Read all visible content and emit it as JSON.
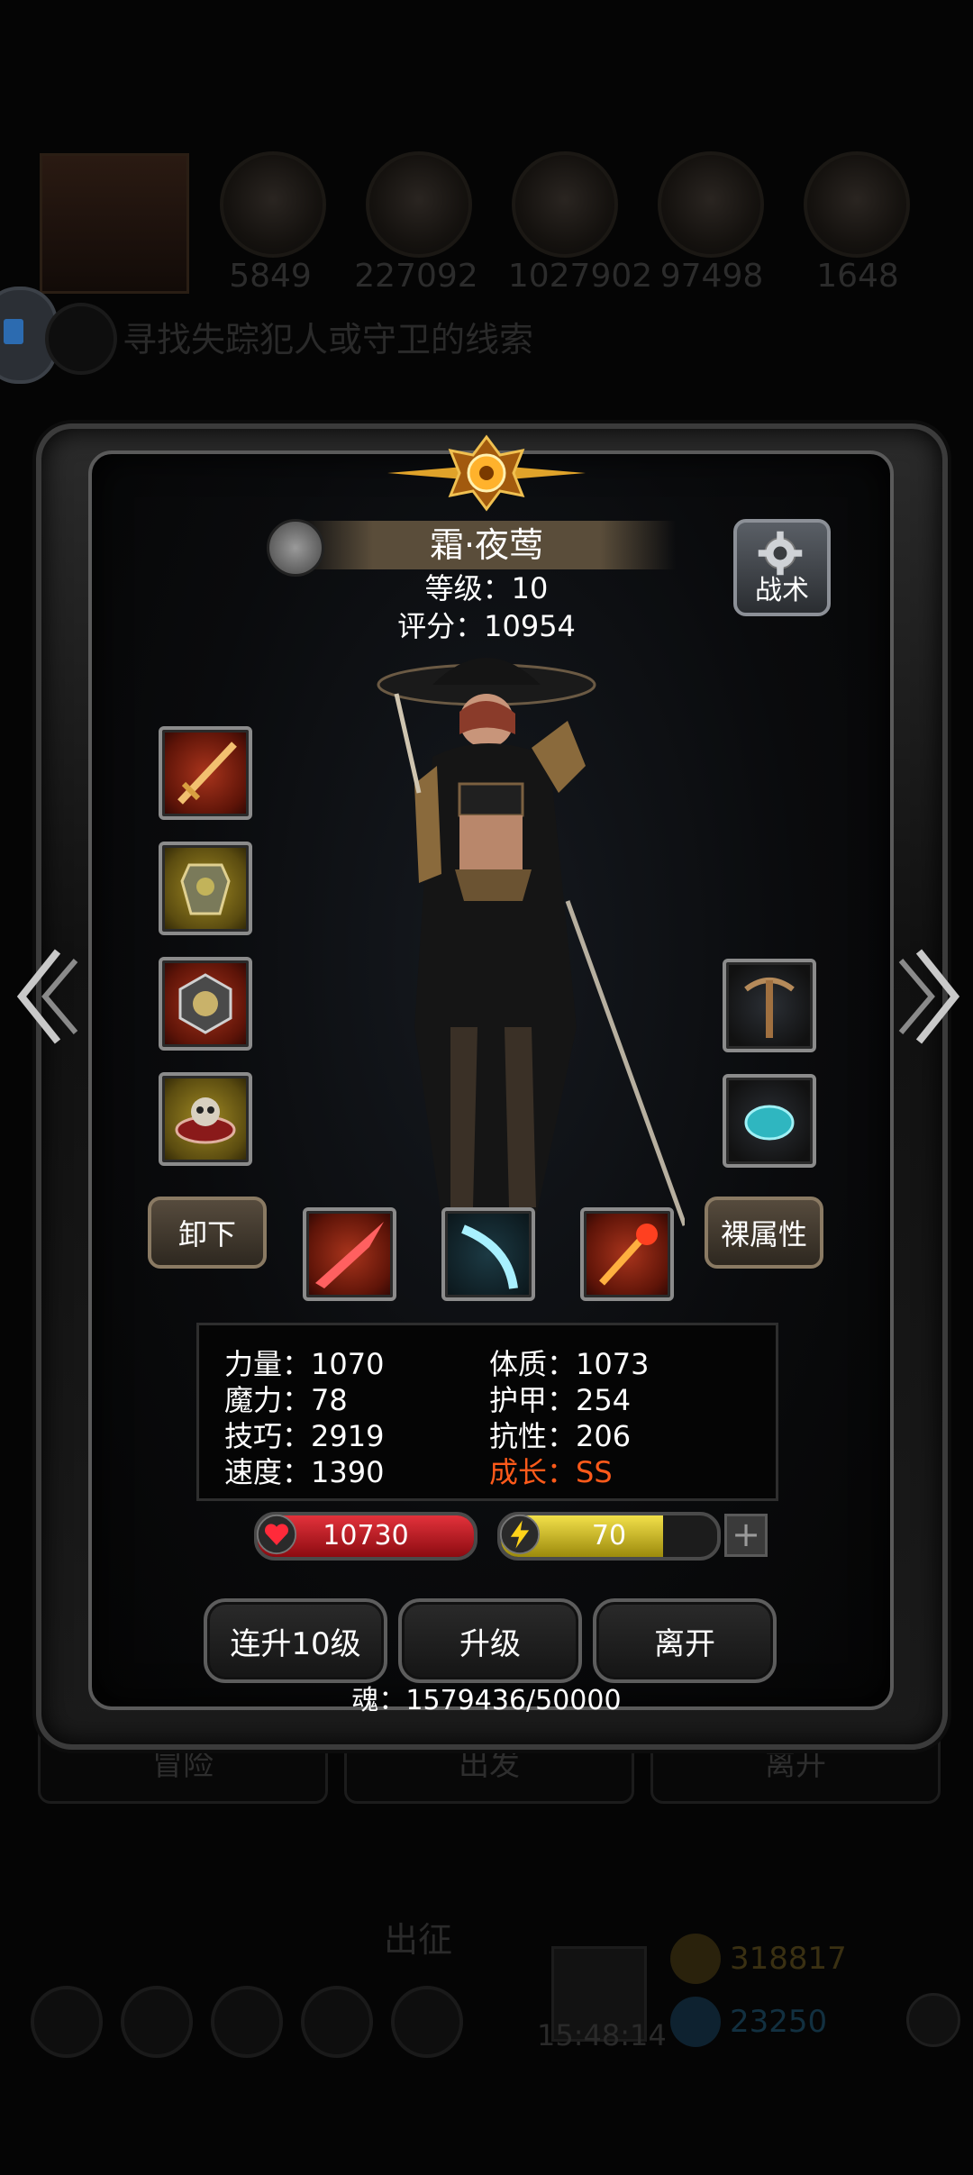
{
  "background": {
    "resources": [
      "5849",
      "227092",
      "1027902",
      "97498",
      "1648"
    ],
    "quest_text": "寻找失踪犯人或守卫的线索",
    "bottom_buttons": [
      "冒险",
      "出发",
      "离开"
    ],
    "march_label": "出征",
    "currency_gold": "318817",
    "currency_gem": "23250",
    "time": "15:48:14"
  },
  "hero": {
    "name": "霜·夜莺",
    "level_label": "等级：",
    "level": "10",
    "score_label": "评分：",
    "score": "10954"
  },
  "buttons": {
    "tactics": "战术",
    "unequip": "卸下",
    "bare_attributes": "裸属性",
    "level_up_10": "连升10级",
    "level_up": "升级",
    "leave": "离开"
  },
  "stats": {
    "strength": "力量：1070",
    "magic": "魔力：78",
    "skill": "技巧：2919",
    "speed": "速度：1390",
    "constitution": "体质：1073",
    "armor": "护甲：254",
    "resistance": "抗性：206",
    "growth": "成长：SS"
  },
  "bars": {
    "hp": "10730",
    "energy": "70",
    "energy_fraction": 0.75
  },
  "soul_text": "魂：1579436/50000",
  "colors": {
    "growth": "#ff5a1a",
    "hp_fill": "#c4121b",
    "energy_fill": "#d6c21e"
  }
}
